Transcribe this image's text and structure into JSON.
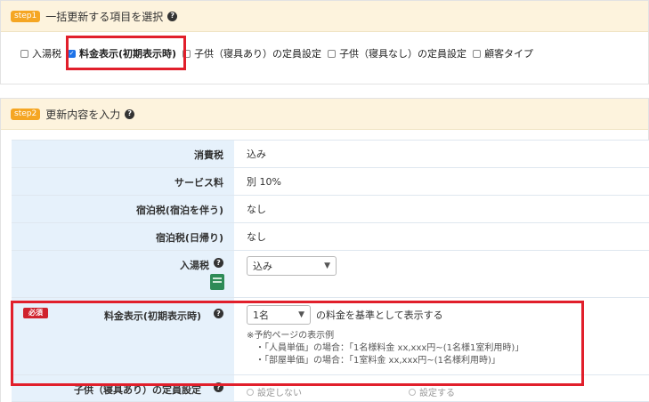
{
  "step1": {
    "badge": "step1",
    "title": "一括更新する項目を選択",
    "options": [
      {
        "label": "入湯税",
        "checked": false
      },
      {
        "label": "料金表示(初期表示時)",
        "checked": true
      },
      {
        "label": "子供（寝具あり）の定員設定",
        "checked": false
      },
      {
        "label": "子供（寝具なし）の定員設定",
        "checked": false
      },
      {
        "label": "顧客タイプ",
        "checked": false
      }
    ]
  },
  "step2": {
    "badge": "step2",
    "title": "更新内容を入力",
    "rows": {
      "tax": {
        "label": "消費税",
        "value": "込み"
      },
      "service": {
        "label": "サービス料",
        "value": "別 10%"
      },
      "lodging_tax": {
        "label": "宿泊税(宿泊を伴う)",
        "value": "なし"
      },
      "lodging_tax_day": {
        "label": "宿泊税(日帰り)",
        "value": "なし"
      },
      "bath_tax": {
        "label": "入湯税",
        "selected": "込み"
      },
      "price_display": {
        "required": "必須",
        "label": "料金表示(初期表示時)",
        "selected": "1名",
        "suffix": "の料金を基準として表示する",
        "note_title": "※予約ページの表示例",
        "note_lines": [
          "・「人員単価」の場合：「1名様料金 xx,xxx円~(1名様1室利用時)」",
          "・「部屋単価」の場合：「1室料金 xx,xxx円~(1名様利用時)」"
        ]
      },
      "child_bed": {
        "label": "子供（寝具あり）の定員設定",
        "opt1": "設定しない",
        "opt2": "設定する"
      }
    }
  },
  "colors": {
    "highlight": "#e11f2b",
    "header_bg": "#fdf3dd",
    "badge": "#f5a623",
    "label_bg": "#e6f1fb",
    "checkbox": "#1e73e8"
  }
}
